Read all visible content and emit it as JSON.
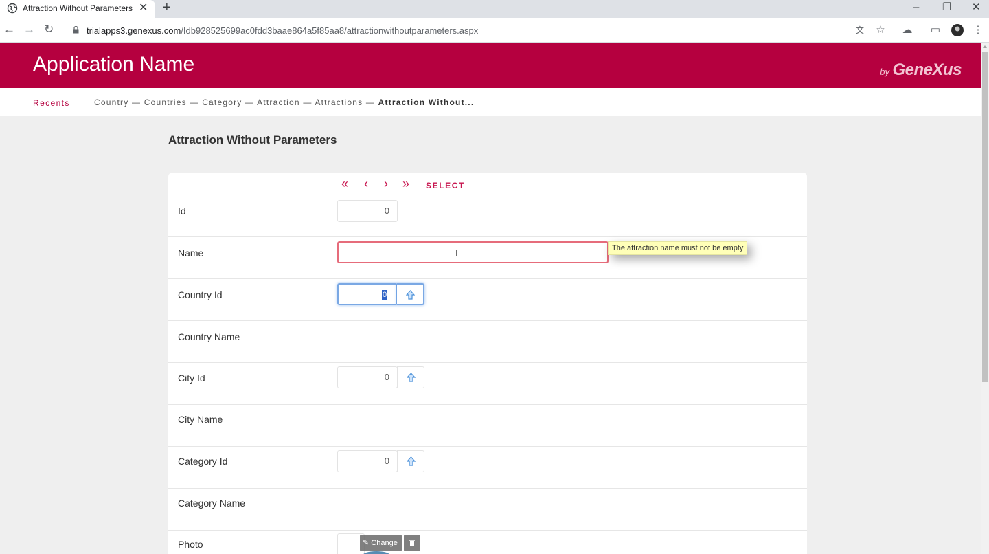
{
  "browser": {
    "tab_title": "Attraction Without Parameters",
    "tab_close": "✕",
    "new_tab": "+",
    "url_host": "trialapps3.genexus.com",
    "url_path": "/Idb928525699ac0fdd3baae864a5f85aa8/attractionwithoutparameters.aspx"
  },
  "header": {
    "app_name": "Application Name",
    "brand_by": "by",
    "brand_name": "GeneXus",
    "brand_color": "#b5003f"
  },
  "recents": {
    "label": "Recents",
    "crumbs": [
      "Country",
      "Countries",
      "Category",
      "Attraction",
      "Attractions",
      "Attraction Without..."
    ],
    "separator": "—"
  },
  "page": {
    "title": "Attraction Without Parameters"
  },
  "navigation": {
    "first": "«",
    "prev": "‹",
    "next": "›",
    "last": "»",
    "select": "SELECT"
  },
  "form": {
    "id": {
      "label": "Id",
      "value": "0"
    },
    "name": {
      "label": "Name",
      "value": "",
      "error": "The attraction name must not be empty"
    },
    "country_id": {
      "label": "Country Id",
      "value": "0"
    },
    "country_name": {
      "label": "Country Name"
    },
    "city_id": {
      "label": "City Id",
      "value": "0"
    },
    "city_name": {
      "label": "City Name"
    },
    "category_id": {
      "label": "Category Id",
      "value": "0"
    },
    "category_name": {
      "label": "Category Name"
    },
    "photo": {
      "label": "Photo",
      "change": "Change"
    }
  }
}
